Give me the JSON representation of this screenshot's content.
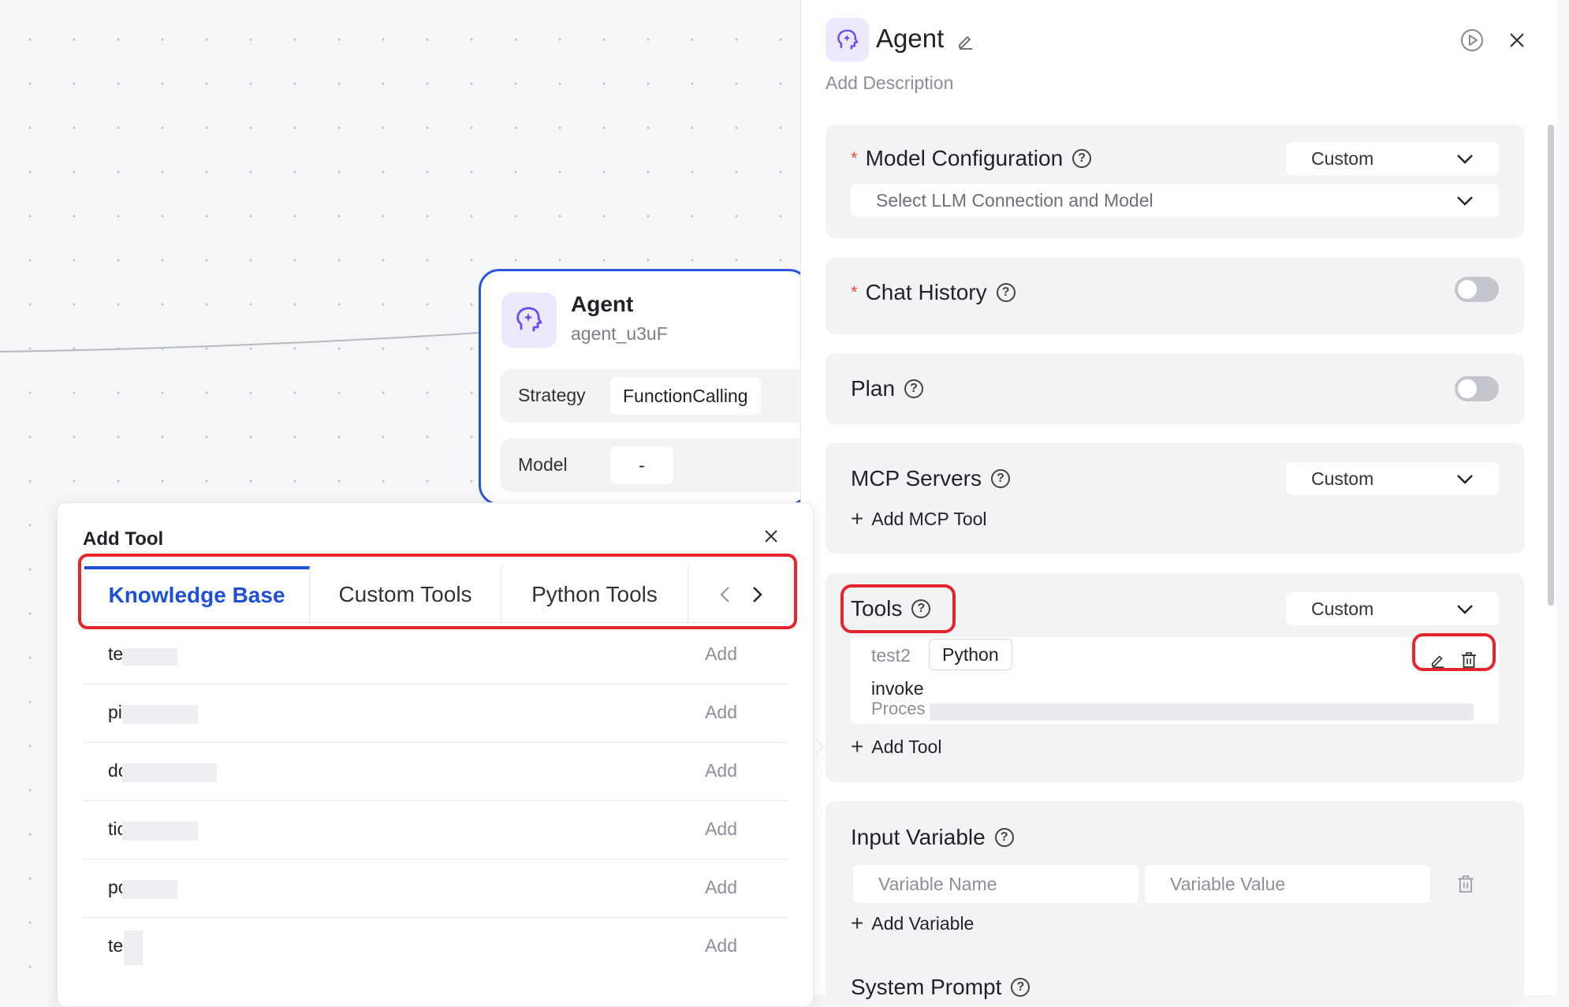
{
  "canvas": {
    "node": {
      "title": "Agent",
      "id": "agent_u3uF",
      "rows": [
        {
          "label": "Strategy",
          "value": "FunctionCalling"
        },
        {
          "label": "Model",
          "value": "-"
        }
      ]
    }
  },
  "panel": {
    "title": "Agent",
    "description_placeholder": "Add Description",
    "sections": {
      "model_config": {
        "title": "Model Configuration",
        "mode": "Custom",
        "select_placeholder": "Select LLM Connection and Model"
      },
      "chat_history": {
        "title": "Chat History",
        "enabled": false
      },
      "plan": {
        "title": "Plan",
        "enabled": false
      },
      "mcp_servers": {
        "title": "MCP Servers",
        "mode": "Custom",
        "add_label": "Add MCP Tool"
      },
      "tools": {
        "title": "Tools",
        "mode": "Custom",
        "items": [
          {
            "name": "test2",
            "type": "Python",
            "function": "invoke",
            "description": "Proces"
          }
        ],
        "add_label": "Add Tool"
      },
      "input_variable": {
        "title": "Input Variable",
        "name_placeholder": "Variable Name",
        "value_placeholder": "Variable Value",
        "add_label": "Add Variable"
      },
      "system_prompt": {
        "title": "System Prompt"
      }
    }
  },
  "add_tool_popup": {
    "title": "Add Tool",
    "tabs": [
      "Knowledge Base",
      "Custom Tools",
      "Python Tools"
    ],
    "active_tab": "Knowledge Base",
    "rows": [
      {
        "name": "te",
        "action": "Add"
      },
      {
        "name": "pi",
        "action": "Add"
      },
      {
        "name": "dc",
        "action": "Add"
      },
      {
        "name": "tic",
        "action": "Add"
      },
      {
        "name": "pc",
        "action": "Add"
      },
      {
        "name": "te",
        "action": "Add"
      }
    ]
  },
  "colors": {
    "accent": "#1e4fd8",
    "node_border": "#2b55e0",
    "highlight": "#e5242b",
    "required": "#f04a3e",
    "icon_bg": "#ece9fd"
  }
}
